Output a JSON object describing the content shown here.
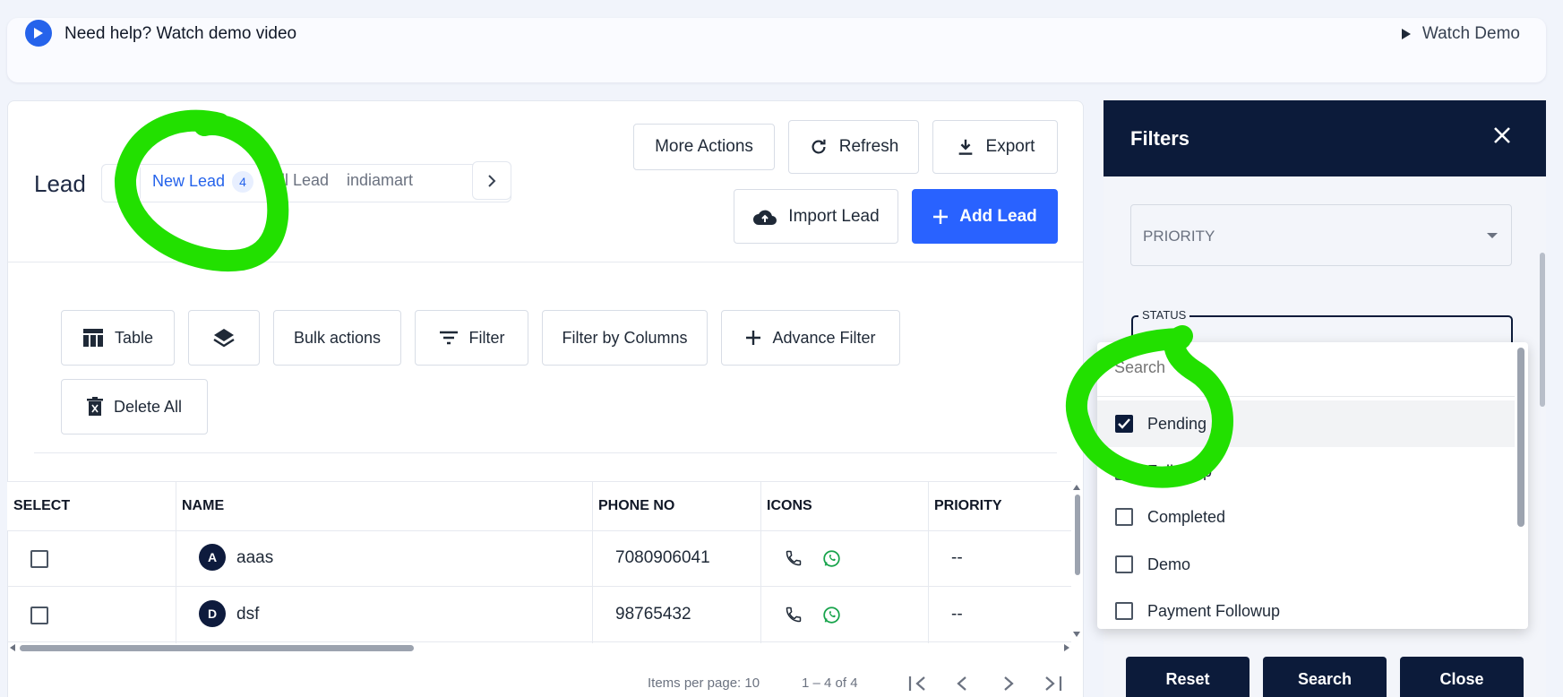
{
  "help": {
    "text": "Need help? Watch demo video",
    "watch_label": "Watch Demo"
  },
  "lead": {
    "title": "Lead",
    "tabs": [
      {
        "label": "New Lead",
        "count": "4",
        "active": true
      },
      {
        "label": "All Lead"
      },
      {
        "label": "indiamart"
      }
    ]
  },
  "actions": {
    "more": "More Actions",
    "refresh": "Refresh",
    "export": "Export",
    "import": "Import Lead",
    "add": "Add Lead"
  },
  "toolbar": {
    "table": "Table",
    "bulk": "Bulk actions",
    "filter": "Filter",
    "filter_columns": "Filter by Columns",
    "advance": "Advance Filter",
    "delete_all": "Delete All"
  },
  "table": {
    "columns": [
      "SELECT",
      "NAME",
      "PHONE NO",
      "ICONS",
      "PRIORITY"
    ],
    "rows": [
      {
        "initial": "A",
        "name": "aaas",
        "phone": "7080906041",
        "priority": "--"
      },
      {
        "initial": "D",
        "name": "dsf",
        "phone": "98765432",
        "priority": "--"
      }
    ]
  },
  "pagination": {
    "items_per_page": "Items per page: 10",
    "range": "1 – 4 of 4"
  },
  "filters": {
    "title": "Filters",
    "priority_placeholder": "PRIORITY",
    "status_label": "STATUS",
    "search_placeholder": "Search",
    "options": [
      {
        "label": "Pending",
        "checked": true
      },
      {
        "label": "Followup",
        "checked": false
      },
      {
        "label": "Completed",
        "checked": false
      },
      {
        "label": "Demo",
        "checked": false
      },
      {
        "label": "Payment Followup",
        "checked": false
      }
    ],
    "buttons": {
      "reset": "Reset",
      "search": "Search",
      "close": "Close"
    }
  },
  "colors": {
    "accent": "#2962ff",
    "navy": "#0c1b3a",
    "annotation": "#22e000",
    "whatsapp": "#16a34a"
  }
}
